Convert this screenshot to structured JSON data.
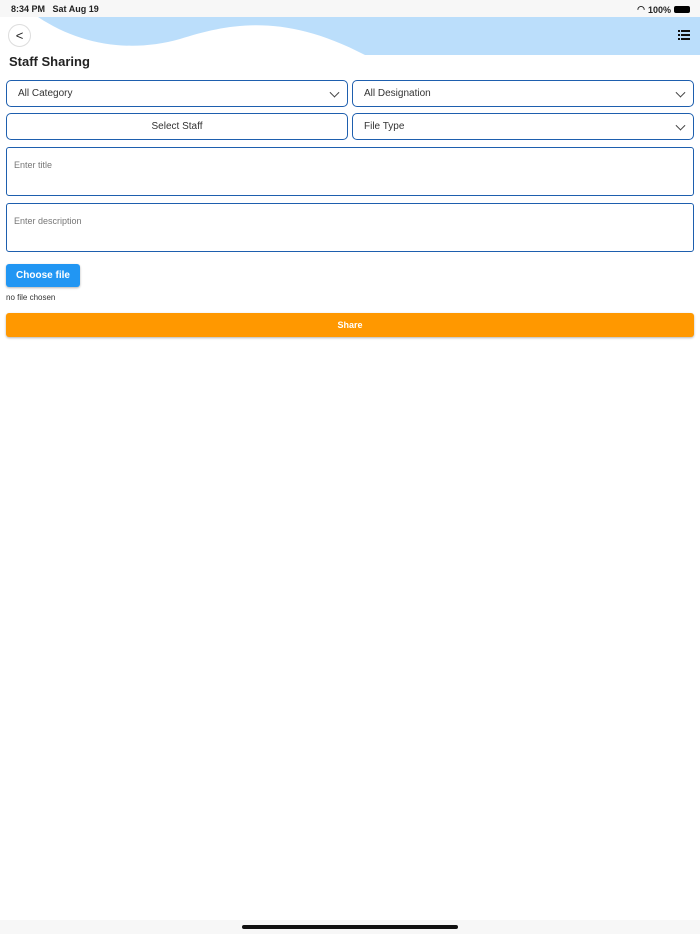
{
  "status": {
    "time": "8:34 PM",
    "date": "Sat Aug 19",
    "battery": "100%"
  },
  "header": {
    "title": "Staff Sharing"
  },
  "form": {
    "category": "All Category",
    "designation": "All Designation",
    "staff": "Select Staff",
    "file_type": "File Type",
    "title_placeholder": "Enter title",
    "description_placeholder": "Enter description",
    "choose_file": "Choose file",
    "file_status": "no file chosen",
    "share": "Share"
  },
  "colors": {
    "accent": "#2196f3",
    "share": "#ff9800",
    "border": "#1e5fae",
    "wave": "#bbdefb"
  }
}
